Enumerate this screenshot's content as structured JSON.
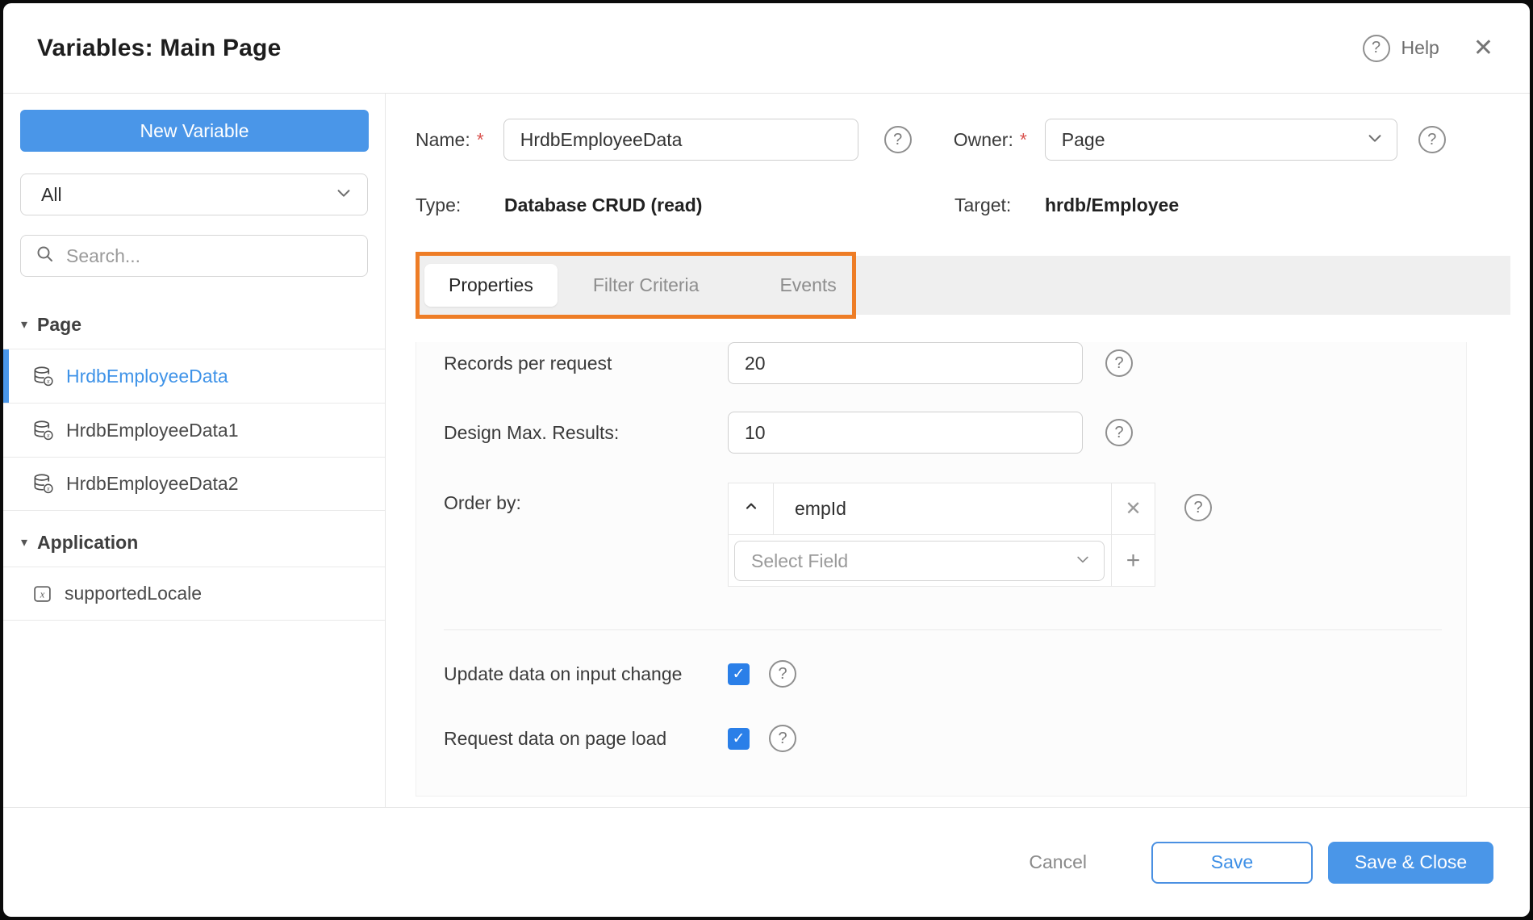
{
  "dialog": {
    "title": "Variables: Main Page",
    "help_label": "Help"
  },
  "icons": {
    "help": "?",
    "close": "✕",
    "caret_down": "▾",
    "checkmark": "✓",
    "remove": "✕",
    "add": "+"
  },
  "sidebar": {
    "new_variable_button": "New Variable",
    "filter_select_value": "All",
    "search_placeholder": "Search...",
    "sections": [
      {
        "label": "Page",
        "items": [
          {
            "label": "HrdbEmployeeData",
            "icon": "database-variable-icon",
            "selected": true
          },
          {
            "label": "HrdbEmployeeData1",
            "icon": "database-variable-icon",
            "selected": false
          },
          {
            "label": "HrdbEmployeeData2",
            "icon": "database-variable-icon",
            "selected": false
          }
        ]
      },
      {
        "label": "Application",
        "items": [
          {
            "label": "supportedLocale",
            "icon": "static-variable-icon",
            "selected": false
          }
        ]
      }
    ]
  },
  "form": {
    "required_marker": "*",
    "name": {
      "label": "Name:",
      "value": "HrdbEmployeeData",
      "required": true
    },
    "owner": {
      "label": "Owner:",
      "value": "Page",
      "required": true
    },
    "type": {
      "label": "Type:",
      "value": "Database CRUD (read)"
    },
    "target": {
      "label": "Target:",
      "value": "hrdb/Employee"
    }
  },
  "tabs": [
    {
      "label": "Properties",
      "active": true
    },
    {
      "label": "Filter Criteria",
      "active": false
    },
    {
      "label": "Events",
      "active": false
    }
  ],
  "properties": {
    "records_per_request": {
      "label": "Records per request",
      "value": "20"
    },
    "design_max_results": {
      "label": "Design Max. Results:",
      "value": "10"
    },
    "order_by": {
      "label": "Order by:",
      "field": "empId",
      "sort_direction": "ascending",
      "select_placeholder": "Select Field"
    },
    "update_on_input_change": {
      "label": "Update data on input change",
      "checked": true
    },
    "request_on_page_load": {
      "label": "Request data on page load",
      "checked": true
    }
  },
  "footer": {
    "cancel_label": "Cancel",
    "save_label": "Save",
    "save_close_label": "Save & Close"
  },
  "colors": {
    "accent_blue": "#4a96e8",
    "selected_text_blue": "#3f93e8",
    "checkbox_blue": "#2a7fe8",
    "highlight_orange": "#ee7d26"
  }
}
